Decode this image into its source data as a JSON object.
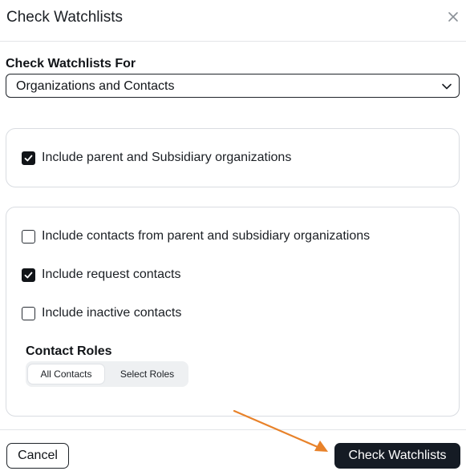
{
  "dialog": {
    "title": "Check Watchlists",
    "close_icon": "close-icon"
  },
  "watchlist_for": {
    "label": "Check Watchlists For",
    "selected": "Organizations and Contacts"
  },
  "organization_options": {
    "include_parent_subsidiary": {
      "label": "Include parent and Subsidiary organizations",
      "checked": true
    }
  },
  "contact_options": [
    {
      "label": "Include contacts from parent and subsidiary organizations",
      "checked": false
    },
    {
      "label": "Include request contacts",
      "checked": true
    },
    {
      "label": "Include inactive contacts",
      "checked": false
    }
  ],
  "contact_roles": {
    "label": "Contact Roles",
    "options": [
      "All Contacts",
      "Select Roles"
    ],
    "selected": "All Contacts"
  },
  "footer": {
    "cancel_label": "Cancel",
    "primary_label": "Check Watchlists"
  },
  "annotation": {
    "arrow_color": "#E8822A"
  }
}
